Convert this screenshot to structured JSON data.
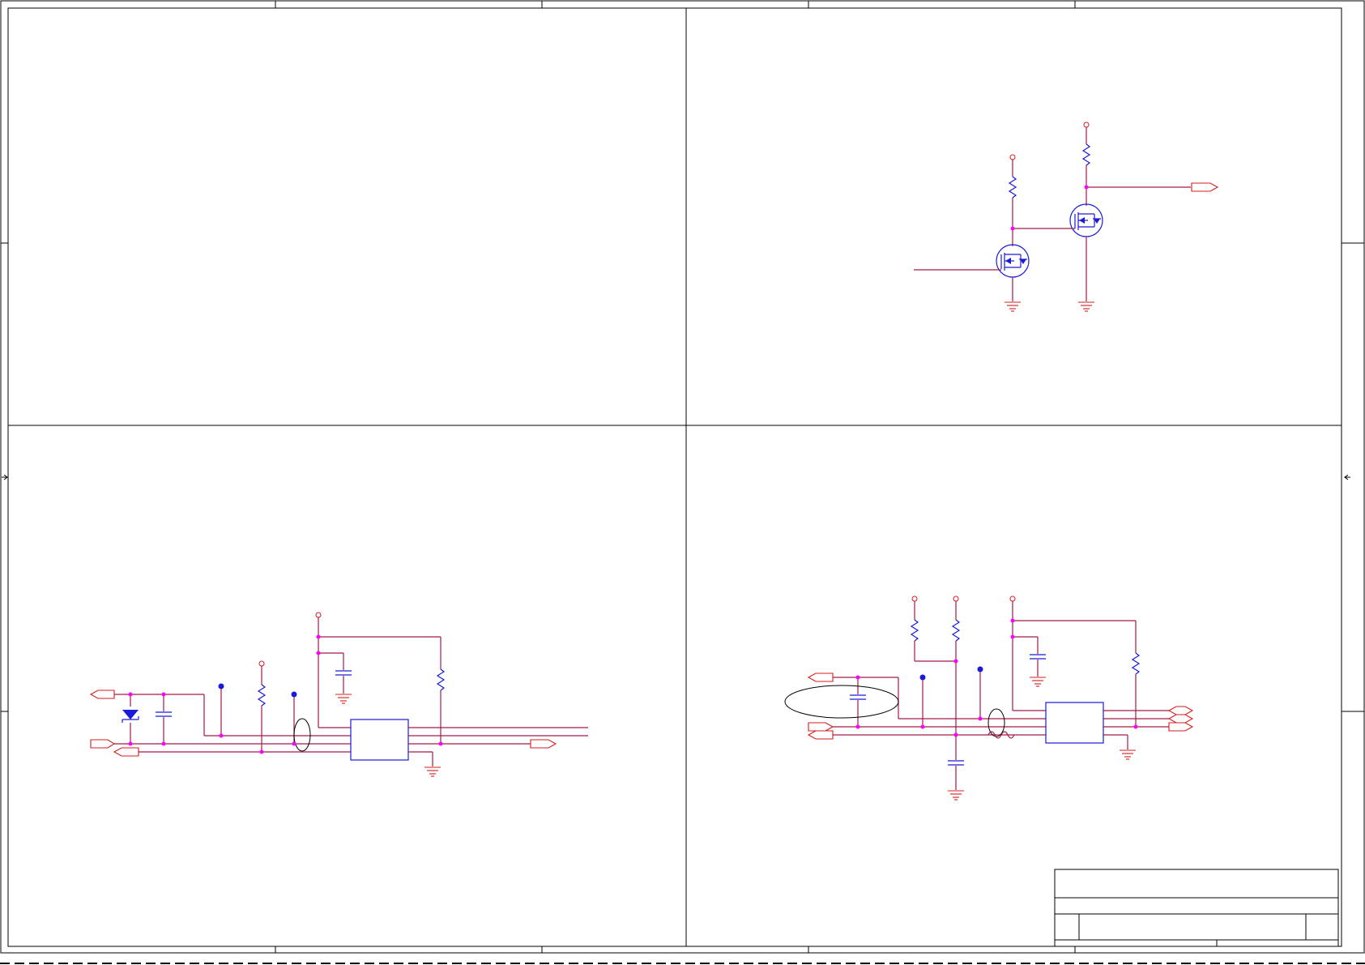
{
  "colors": {
    "wire": "#a31a45",
    "symbol": "#1a1adb",
    "power": "#d41c1c",
    "junction": "#ff00ff",
    "frame": "#000000"
  }
}
